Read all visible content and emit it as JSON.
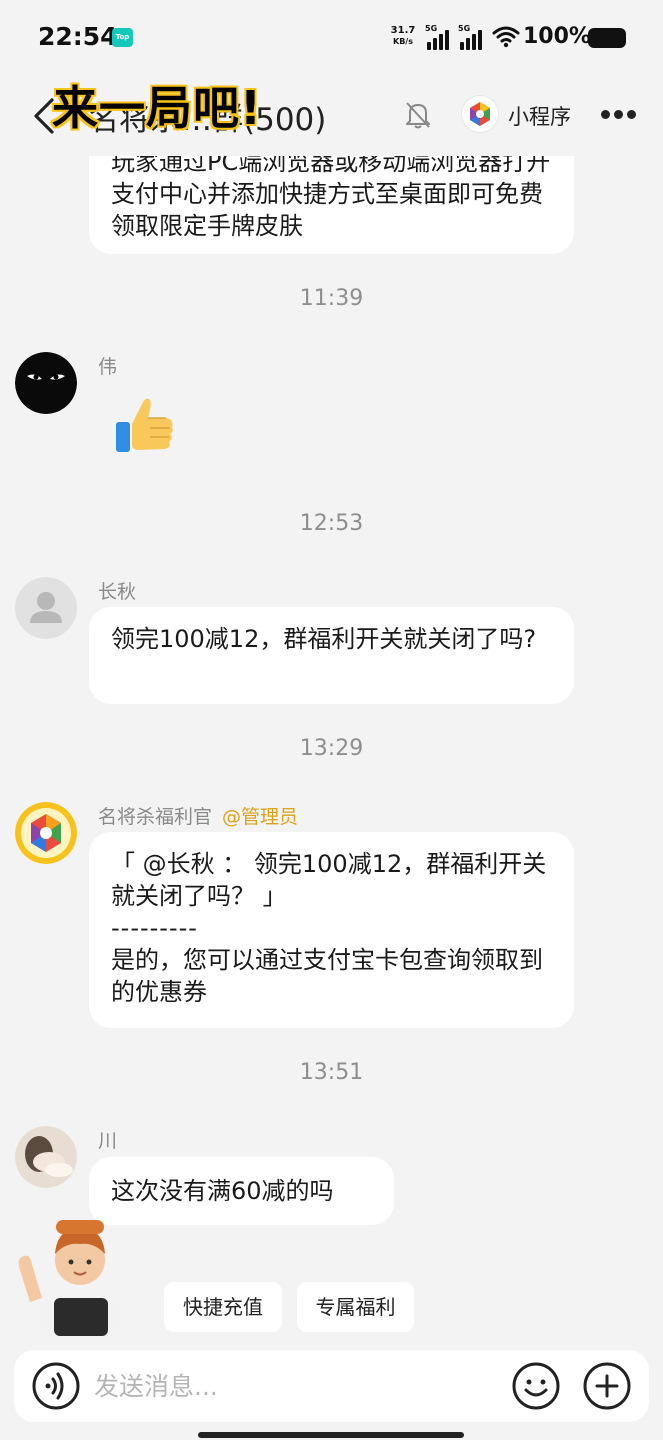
{
  "status_bar": {
    "time": "22:54",
    "app_badge": "Top",
    "net_speed_value": "31.7",
    "net_speed_unit": "KB/s",
    "signal1_label": "5G",
    "signal2_label": "5G",
    "battery": "100%"
  },
  "nav": {
    "title": "名将杀…群(500)",
    "mini_program_label": "小程序"
  },
  "overlay_title": "来一局吧!",
  "messages": {
    "m0_text": "玩家通过PC端浏览器或移动端浏览器打开支付中心并添加快捷方式至桌面即可免费领取限定手牌皮肤",
    "t1": "11:39",
    "m1_sender": "伟",
    "m1_sticker": "👍",
    "t2": "12:53",
    "m2_sender": "长秋",
    "m2_text": "领完100减12，群福利开关就关闭了吗?",
    "t3": "13:29",
    "m3_sender": "名将杀福利官",
    "m3_role": "@管理员",
    "m3_quote": "「 @长秋 ： 领完100减12，群福利开关就关闭了吗？ 」",
    "m3_divider": "---------",
    "m3_text": "是的，您可以通过支付宝卡包查询领取到的优惠券",
    "t4": "13:51",
    "m4_sender": "川",
    "m4_text": "这次没有满60减的吗"
  },
  "quick_actions": {
    "recharge": "快捷充值",
    "welfare": "专属福利"
  },
  "input": {
    "placeholder": "发送消息..."
  },
  "colors": {
    "background": "#f3f3f3",
    "bubble": "#ffffff",
    "admin_tag": "#d9a21b",
    "overlay_stroke": "#f6c21b"
  }
}
